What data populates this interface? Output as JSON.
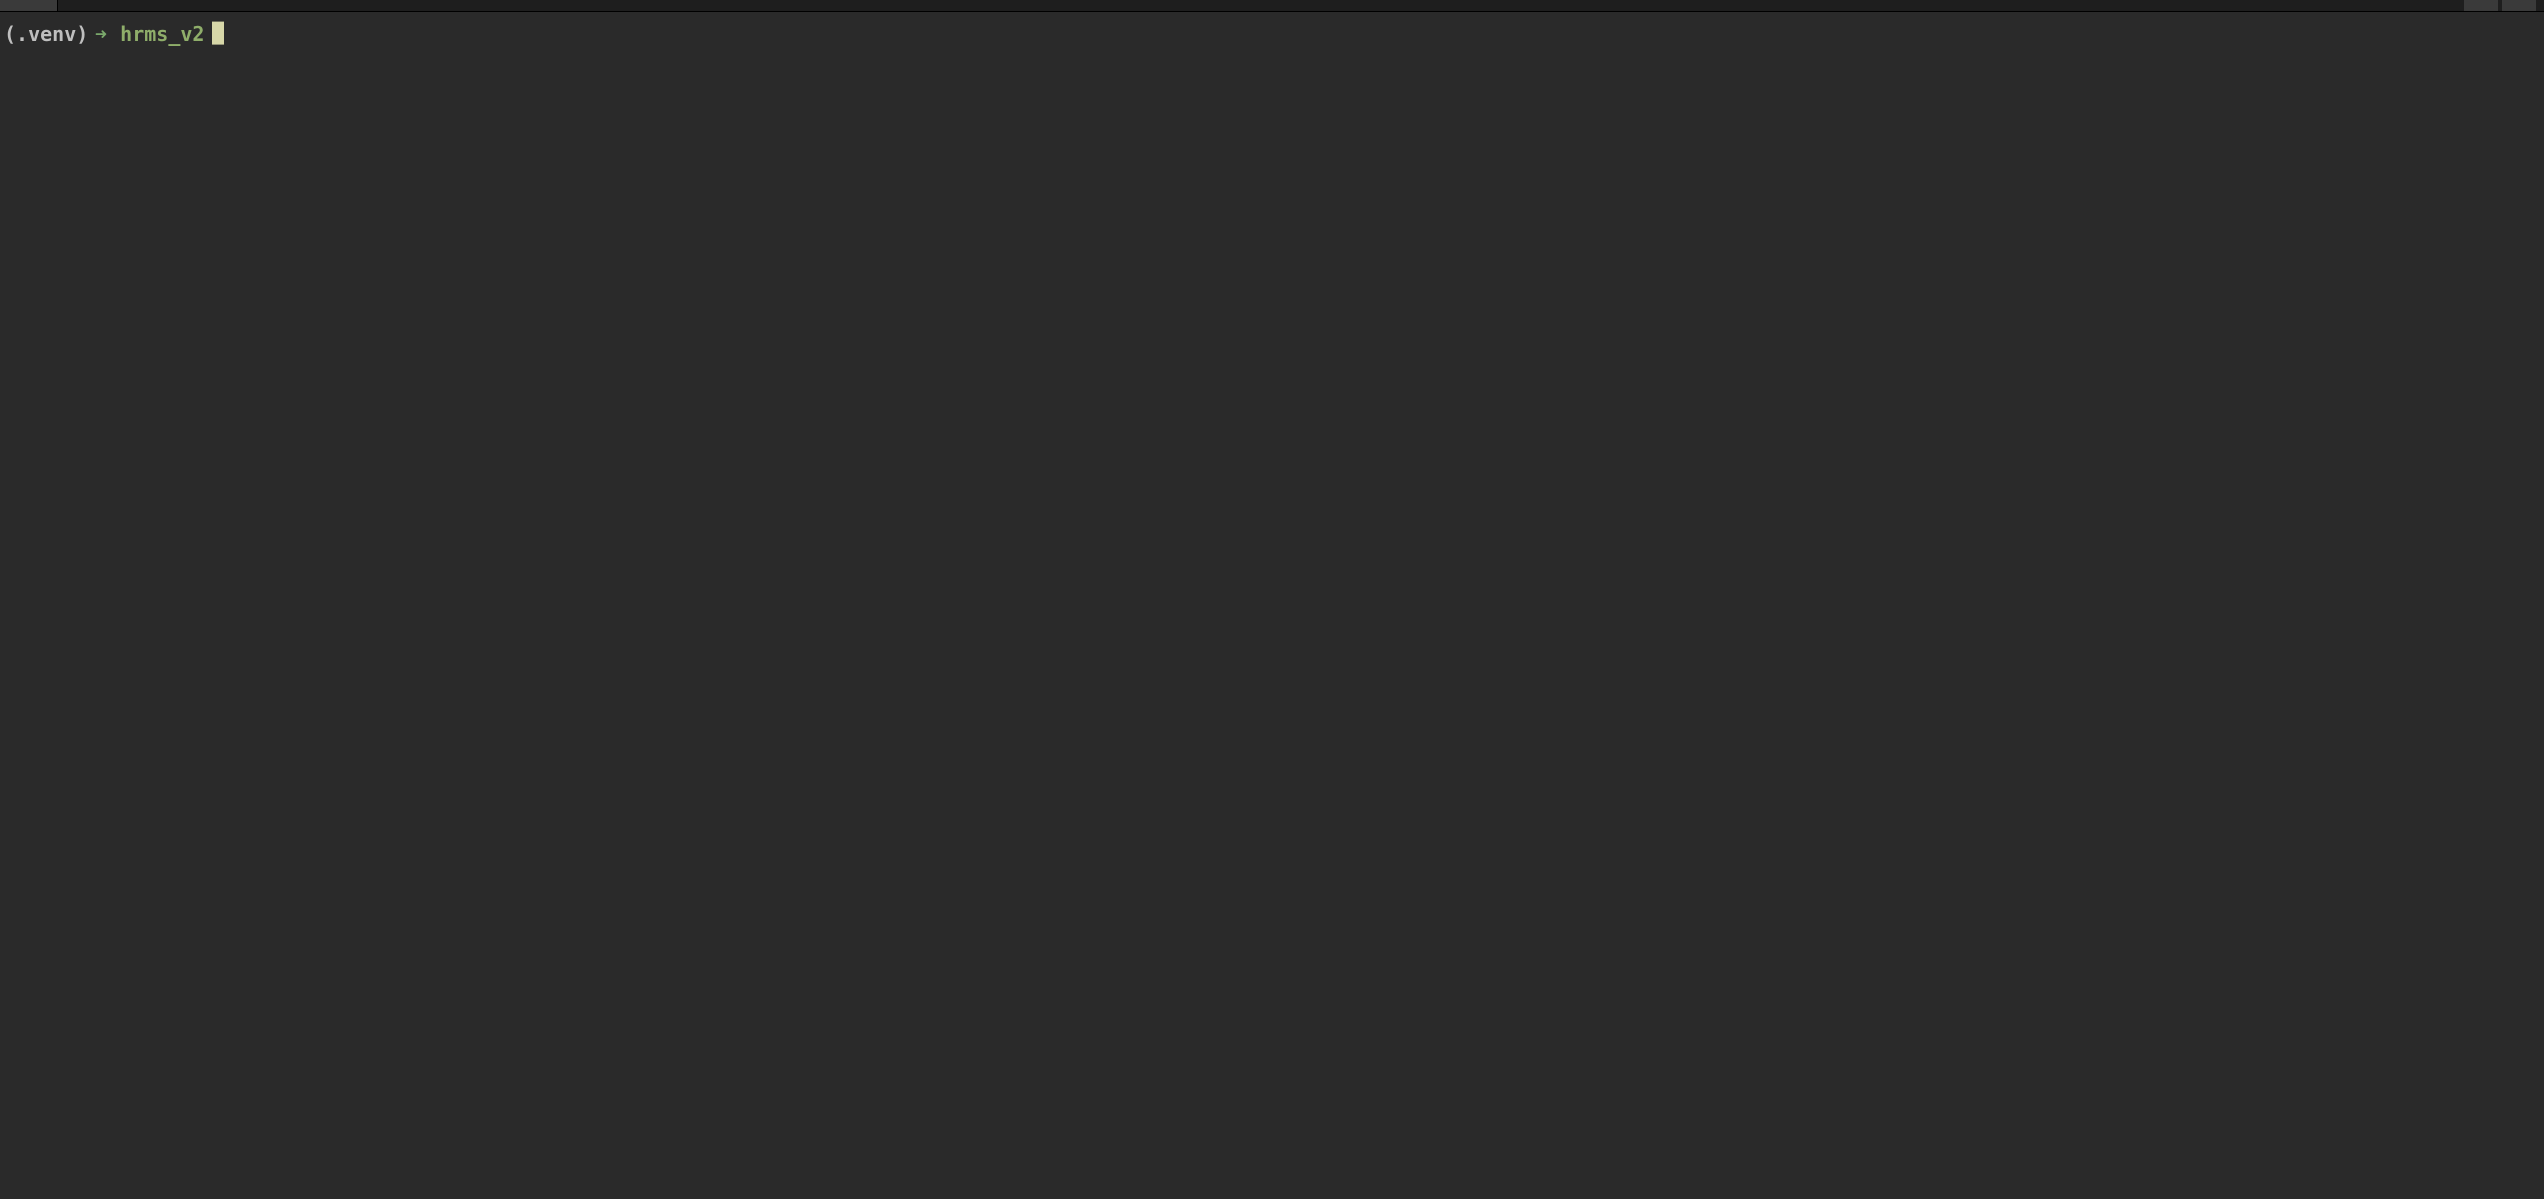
{
  "prompt": {
    "venv": "(.venv)",
    "arrow": "➜",
    "directory": "hrms_v2"
  },
  "colors": {
    "background": "#2a2a2a",
    "titlebar": "#1e1e1e",
    "venv_text": "#bfbfbf",
    "arrow_text": "#7aa86b",
    "dir_text": "#8fae6a",
    "cursor": "#d7d7a8"
  }
}
